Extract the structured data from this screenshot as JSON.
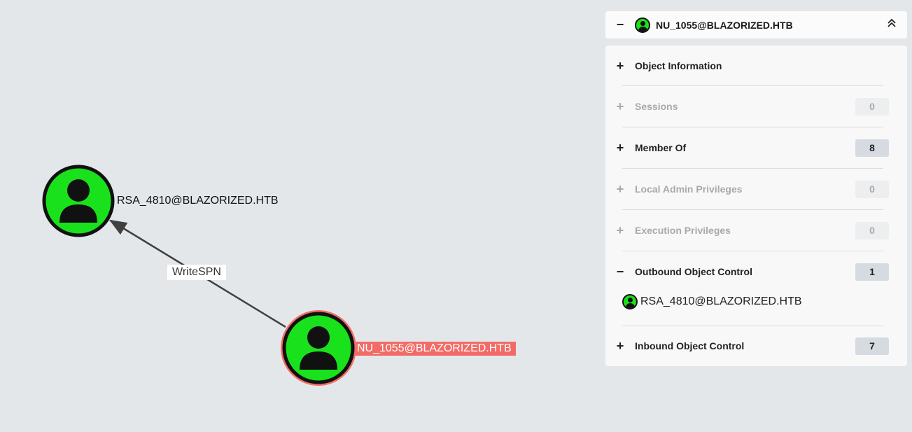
{
  "graph": {
    "nodes": [
      {
        "name": "RSA_4810@BLAZORIZED.HTB",
        "icon": "user-icon",
        "selected": false
      },
      {
        "name": "NU_1055@BLAZORIZED.HTB",
        "icon": "user-icon",
        "selected": true
      }
    ],
    "edge": {
      "label": "WriteSPN"
    },
    "colors": {
      "user_node": "#19e21c",
      "selected_ring": "#f26b66",
      "edge": "#404040"
    }
  },
  "panel": {
    "title": "NU_1055@BLAZORIZED.HTB",
    "collapse_symbol": "−",
    "sections": [
      {
        "sign": "+",
        "label": "Object Information",
        "count": null,
        "enabled": true
      },
      {
        "sign": "+",
        "label": "Sessions",
        "count": "0",
        "enabled": false
      },
      {
        "sign": "+",
        "label": "Member Of",
        "count": "8",
        "enabled": true
      },
      {
        "sign": "+",
        "label": "Local Admin Privileges",
        "count": "0",
        "enabled": false
      },
      {
        "sign": "+",
        "label": "Execution Privileges",
        "count": "0",
        "enabled": false
      },
      {
        "sign": "−",
        "label": "Outbound Object Control",
        "count": "1",
        "enabled": true
      },
      {
        "sign": "+",
        "label": "Inbound Object Control",
        "count": "7",
        "enabled": true
      }
    ],
    "outbound_items": [
      {
        "name": "RSA_4810@BLAZORIZED.HTB",
        "icon": "user-icon"
      }
    ]
  }
}
